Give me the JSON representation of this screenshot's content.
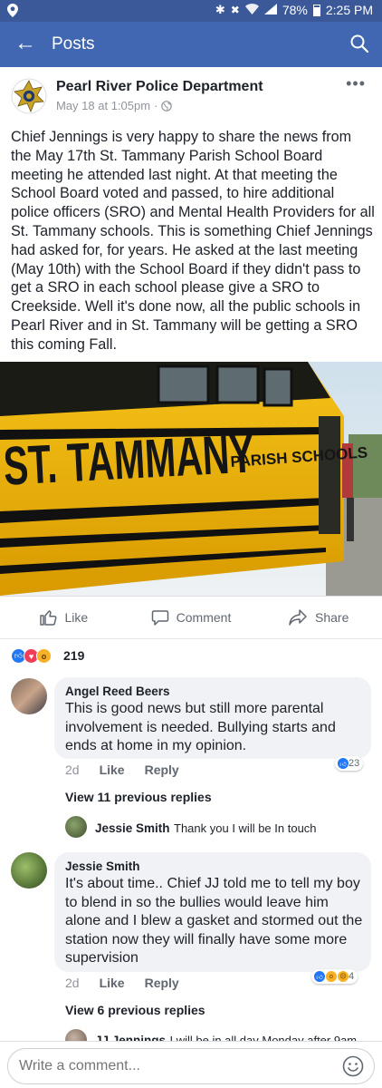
{
  "status_bar": {
    "battery": "78%",
    "time": "2:25 PM",
    "icons": [
      "location-icon",
      "bluetooth-icon",
      "mute-icon",
      "wifi-icon",
      "signal-icon",
      "battery-icon"
    ]
  },
  "app_bar": {
    "title": "Posts",
    "icons": [
      "back-arrow-icon",
      "search-icon"
    ]
  },
  "post": {
    "page_name": "Pearl River Police Department",
    "date": "May 18 at 1:05pm",
    "privacy_icon": "globe-icon",
    "text": "Chief Jennings is very happy to share the news from the May 17th St. Tammany Parish School Board meeting he attended last night. At that meeting the School Board voted and passed, to hire additional police officers (SRO) and Mental Health Providers for all St. Tammany schools. This is something Chief Jennings had asked for, for years. He asked at the last meeting (May 10th) with the School Board if they didn't pass to get a SRO in each school please give a SRO to Creekside. Well it's done now, all the public schools in Pearl River and in St. Tammany will be getting a SRO this coming Fall.",
    "photo_text": {
      "big": "ST. TAMMANY",
      "small": "PARISH SCHOOLS"
    }
  },
  "actions": {
    "like": "Like",
    "comment": "Comment",
    "share": "Share"
  },
  "reactions": {
    "count": "219",
    "types": [
      "like",
      "love",
      "wow"
    ]
  },
  "comments": [
    {
      "author": "Angel Reed Beers",
      "text": "This is good news but still more parental involvement is needed. Bullying starts and ends at home in my opinion.",
      "time": "2d",
      "like": "Like",
      "reply": "Reply",
      "reaction_count": "23",
      "view_replies": "View 11 previous replies",
      "reply_preview": {
        "author": "Jessie Smith",
        "text": "Thank you I will be In touch"
      }
    },
    {
      "author": "Jessie Smith",
      "text": "It's about time.. Chief JJ told me to tell my boy to blend in so the bullies would leave him alone and I blew a gasket and stormed out the station now they will finally have some more supervision",
      "time": "2d",
      "like": "Like",
      "reply": "Reply",
      "reaction_count": "4",
      "view_replies": "View 6 previous replies",
      "reply_preview": {
        "author": "JJ Jennings",
        "text": "I will be in all day Monday after 9am"
      }
    }
  ],
  "compose": {
    "placeholder": "Write a comment..."
  },
  "colors": {
    "brand_blue": "#4267b2",
    "status_blue": "#3b5998",
    "bus_yellow": "#f2b705",
    "like_blue": "#2078f4",
    "love_red": "#f33e58",
    "wow_yellow": "#f7b125"
  }
}
